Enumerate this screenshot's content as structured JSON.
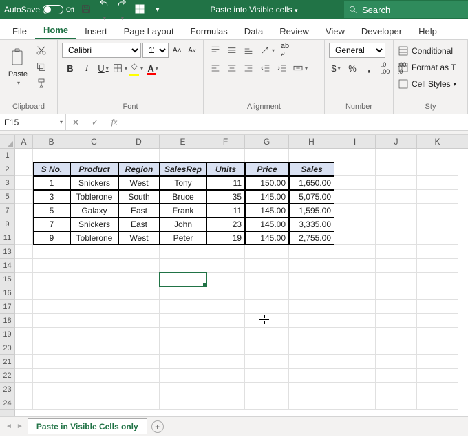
{
  "title_bar": {
    "autosave_label": "AutoSave",
    "autosave_state": "Off",
    "doc_title": "Paste into Visible cells",
    "search_placeholder": "Search"
  },
  "tabs": [
    "File",
    "Home",
    "Insert",
    "Page Layout",
    "Formulas",
    "Data",
    "Review",
    "View",
    "Developer",
    "Help"
  ],
  "active_tab": "Home",
  "ribbon": {
    "clipboard": {
      "label": "Clipboard",
      "paste": "Paste"
    },
    "font": {
      "label": "Font",
      "family": "Calibri",
      "size": "11"
    },
    "alignment": {
      "label": "Alignment"
    },
    "number": {
      "label": "Number",
      "format": "General"
    },
    "styles": {
      "label": "Sty",
      "conditional": "Conditional",
      "format_as": "Format as T",
      "cell_styles": "Cell Styles"
    }
  },
  "namebox": "E15",
  "columns": [
    "A",
    "B",
    "C",
    "D",
    "E",
    "F",
    "G",
    "H",
    "I",
    "J",
    "K"
  ],
  "visible_rows": [
    1,
    2,
    3,
    5,
    7,
    9,
    11,
    13,
    14,
    15,
    16,
    17,
    18,
    19,
    20,
    21,
    22,
    23,
    24
  ],
  "table": {
    "headers": [
      "S No.",
      "Product",
      "Region",
      "SalesRep",
      "Units",
      "Price",
      "Sales"
    ],
    "rows": [
      {
        "sno": "1",
        "product": "Snickers",
        "region": "West",
        "rep": "Tony",
        "units": "11",
        "price": "150.00",
        "sales": "1,650.00"
      },
      {
        "sno": "3",
        "product": "Toblerone",
        "region": "South",
        "rep": "Bruce",
        "units": "35",
        "price": "145.00",
        "sales": "5,075.00"
      },
      {
        "sno": "5",
        "product": "Galaxy",
        "region": "East",
        "rep": "Frank",
        "units": "11",
        "price": "145.00",
        "sales": "1,595.00"
      },
      {
        "sno": "7",
        "product": "Snickers",
        "region": "East",
        "rep": "John",
        "units": "23",
        "price": "145.00",
        "sales": "3,335.00"
      },
      {
        "sno": "9",
        "product": "Toblerone",
        "region": "West",
        "rep": "Peter",
        "units": "19",
        "price": "145.00",
        "sales": "2,755.00"
      }
    ]
  },
  "selected_cell": "E15",
  "sheet_tab": "Paste in Visible Cells only"
}
